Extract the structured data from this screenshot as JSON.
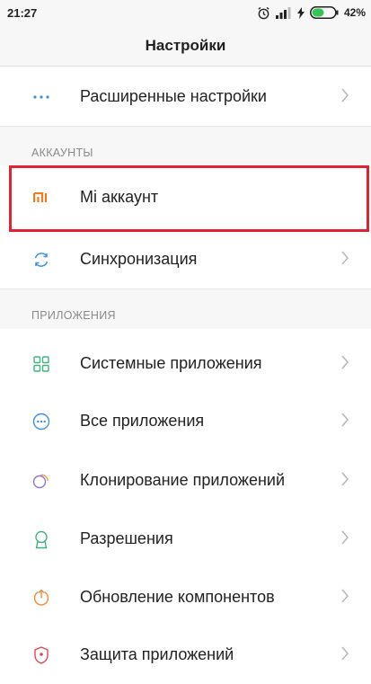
{
  "status_bar": {
    "time": "21:27",
    "battery": "42%",
    "icons": [
      "alarm-icon",
      "signal-icon",
      "charging-icon",
      "battery-icon"
    ]
  },
  "header": {
    "title": "Настройки"
  },
  "sections": {
    "accounts_title": "АККАУНТЫ",
    "apps_title": "ПРИЛОЖЕНИЯ"
  },
  "items": {
    "advanced": {
      "label": "Расширенные настройки",
      "icon": "more-dots-icon"
    },
    "mi_account": {
      "label": "Mi аккаунт",
      "icon": "mi-logo-icon"
    },
    "sync": {
      "label": "Синхронизация",
      "icon": "sync-icon"
    },
    "system_apps": {
      "label": "Системные приложения",
      "icon": "grid-icon"
    },
    "all_apps": {
      "label": "Все приложения",
      "icon": "apps-dots-icon"
    },
    "clone_apps": {
      "label": "Клонирование приложений",
      "icon": "clone-icon"
    },
    "permissions": {
      "label": "Разрешения",
      "icon": "permissions-icon"
    },
    "updates": {
      "label": "Обновление компонентов",
      "icon": "update-icon"
    },
    "app_protection": {
      "label": "Защита приложений",
      "icon": "lock-icon"
    }
  },
  "colors": {
    "accent_highlight": "#e02232",
    "mi_orange": "#f47a20",
    "icon_blue": "#3d8fe0",
    "icon_green": "#3fb37f"
  }
}
